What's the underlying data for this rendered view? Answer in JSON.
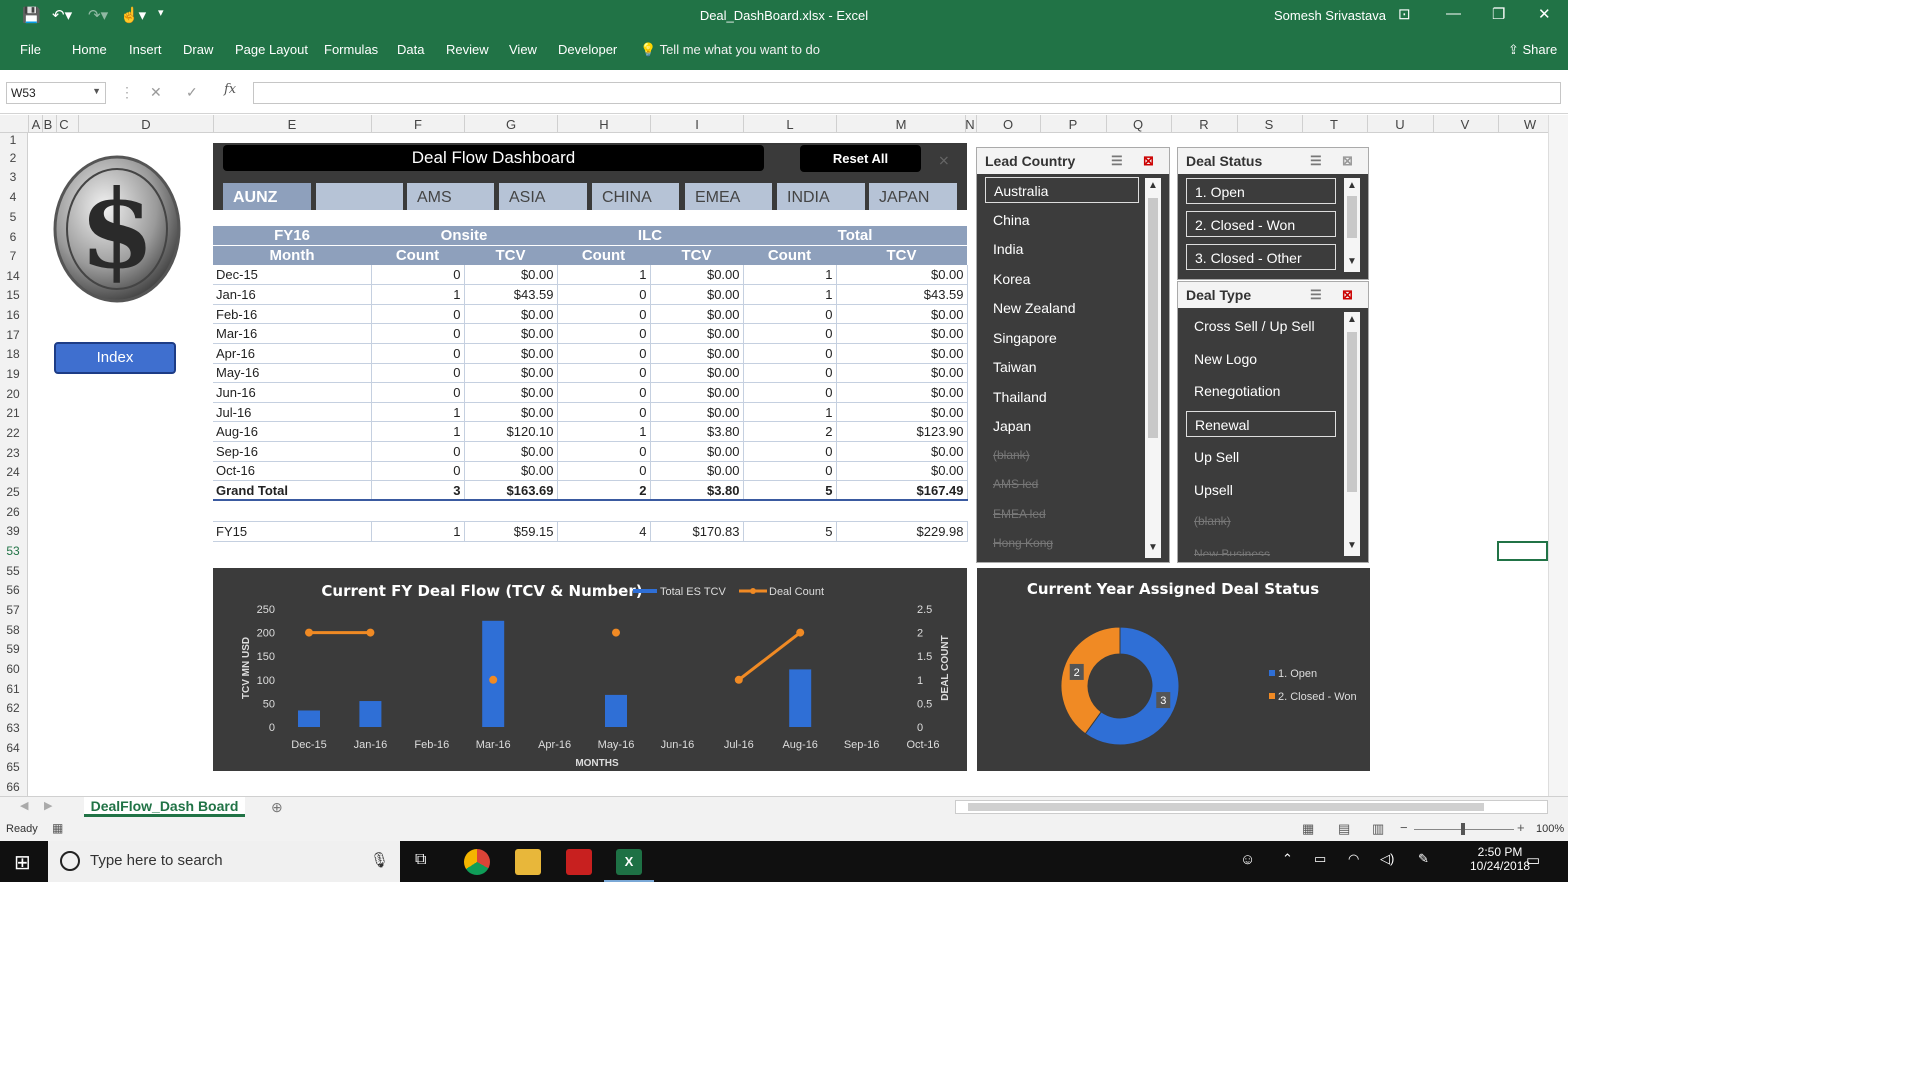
{
  "window": {
    "title": "Deal_DashBoard.xlsx  -  Excel",
    "user": "Somesh Srivastava"
  },
  "ribbon": {
    "tabs": [
      "File",
      "Home",
      "Insert",
      "Draw",
      "Page Layout",
      "Formulas",
      "Data",
      "Review",
      "View",
      "Developer"
    ],
    "tell_me": "Tell me what you want to do",
    "share": "Share"
  },
  "formula_bar": {
    "name_box": "W53",
    "fx": "fx",
    "value": ""
  },
  "columns": [
    "A",
    "B",
    "C",
    "D",
    "E",
    "F",
    "G",
    "H",
    "I",
    "L",
    "M",
    "N",
    "O",
    "P",
    "Q",
    "R",
    "S",
    "T",
    "U",
    "V",
    "W"
  ],
  "rows": [
    "1",
    "2",
    "3",
    "4",
    "5",
    "6",
    "7",
    "14",
    "15",
    "16",
    "17",
    "18",
    "19",
    "20",
    "21",
    "22",
    "23",
    "24",
    "25",
    "26",
    "39",
    "53",
    "55",
    "56",
    "57",
    "58",
    "59",
    "60",
    "61",
    "62",
    "63",
    "64",
    "65",
    "66"
  ],
  "dashboard": {
    "title": "Deal Flow Dashboard",
    "reset_label": "Reset All",
    "index_label": "Index",
    "region_tabs": [
      "AUNZ",
      "",
      "AMS",
      "ASIA",
      "CHINA",
      "EMEA",
      "INDIA",
      "JAPAN"
    ]
  },
  "table": {
    "fy": "FY16",
    "groups": [
      "Onsite",
      "ILC",
      "Total"
    ],
    "month_hdr": "Month",
    "count_hdr": "Count",
    "tcv_hdr": "TCV",
    "rows": [
      [
        "Dec-15",
        "0",
        "$0.00",
        "1",
        "$0.00",
        "1",
        "$0.00"
      ],
      [
        "Jan-16",
        "1",
        "$43.59",
        "0",
        "$0.00",
        "1",
        "$43.59"
      ],
      [
        "Feb-16",
        "0",
        "$0.00",
        "0",
        "$0.00",
        "0",
        "$0.00"
      ],
      [
        "Mar-16",
        "0",
        "$0.00",
        "0",
        "$0.00",
        "0",
        "$0.00"
      ],
      [
        "Apr-16",
        "0",
        "$0.00",
        "0",
        "$0.00",
        "0",
        "$0.00"
      ],
      [
        "May-16",
        "0",
        "$0.00",
        "0",
        "$0.00",
        "0",
        "$0.00"
      ],
      [
        "Jun-16",
        "0",
        "$0.00",
        "0",
        "$0.00",
        "0",
        "$0.00"
      ],
      [
        "Jul-16",
        "1",
        "$0.00",
        "0",
        "$0.00",
        "1",
        "$0.00"
      ],
      [
        "Aug-16",
        "1",
        "$120.10",
        "1",
        "$3.80",
        "2",
        "$123.90"
      ],
      [
        "Sep-16",
        "0",
        "$0.00",
        "0",
        "$0.00",
        "0",
        "$0.00"
      ],
      [
        "Oct-16",
        "0",
        "$0.00",
        "0",
        "$0.00",
        "0",
        "$0.00"
      ]
    ],
    "grand_total": [
      "Grand Total",
      "3",
      "$163.69",
      "2",
      "$3.80",
      "5",
      "$167.49"
    ],
    "fy15": [
      "FY15",
      "1",
      "$59.15",
      "4",
      "$170.83",
      "5",
      "$229.98"
    ]
  },
  "slicers": {
    "lead_country": {
      "title": "Lead Country",
      "items": [
        "Australia",
        "China",
        "India",
        "Korea",
        "New Zealand",
        "Singapore",
        "Taiwan",
        "Thailand",
        "Japan"
      ],
      "dim_items": [
        "(blank)",
        "AMS led",
        "EMEA led",
        "Hong Kong"
      ]
    },
    "deal_status": {
      "title": "Deal Status",
      "items": [
        "1. Open",
        "2. Closed - Won",
        "3. Closed - Other"
      ]
    },
    "deal_type": {
      "title": "Deal Type",
      "items": [
        "Cross Sell / Up Sell",
        "New Logo",
        "Renegotiation",
        "Renewal",
        "Up Sell",
        "Upsell"
      ],
      "dim_items": [
        "(blank)",
        "New Business"
      ]
    }
  },
  "chart_data": [
    {
      "type": "bar",
      "title": "Current FY Deal Flow (TCV & Number)",
      "xlabel": "MONTHS",
      "ylabel": "TCV MN USD",
      "y2label": "DEAL COUNT",
      "categories": [
        "Dec-15",
        "Jan-16",
        "Feb-16",
        "Mar-16",
        "Apr-16",
        "May-16",
        "Jun-16",
        "Jul-16",
        "Aug-16",
        "Sep-16",
        "Oct-16"
      ],
      "ylim": [
        0,
        250
      ],
      "y2lim": [
        0,
        2.5
      ],
      "yticks": [
        "0",
        "50",
        "100",
        "150",
        "200",
        "250"
      ],
      "y2ticks": [
        "0",
        "0.5",
        "1",
        "1.5",
        "2",
        "2.5"
      ],
      "series": [
        {
          "name": "Total ES TCV",
          "type": "bar",
          "color": "#2f6fd6",
          "values": [
            35,
            55,
            null,
            225,
            null,
            68,
            null,
            null,
            122,
            null,
            null
          ]
        },
        {
          "name": "Deal Count",
          "type": "line",
          "color": "#f08a24",
          "values": [
            2,
            2,
            null,
            1,
            null,
            2,
            null,
            1,
            2,
            null,
            null
          ]
        }
      ],
      "legend": "top-right"
    },
    {
      "type": "pie",
      "title": "Current Year Assigned Deal Status",
      "legend": "right",
      "series": [
        {
          "name": "1. Open",
          "color": "#2f6fd6",
          "values": [
            3
          ]
        },
        {
          "name": "2. Closed - Won",
          "color": "#f08a24",
          "values": [
            2
          ]
        }
      ],
      "labels": [
        "3",
        "2"
      ]
    }
  ],
  "sheet_tab": "DealFlow_Dash Board",
  "status": {
    "ready": "Ready",
    "zoom": "100%"
  },
  "taskbar": {
    "search_placeholder": "Type here to search",
    "time": "2:50 PM",
    "date": "10/24/2018"
  }
}
